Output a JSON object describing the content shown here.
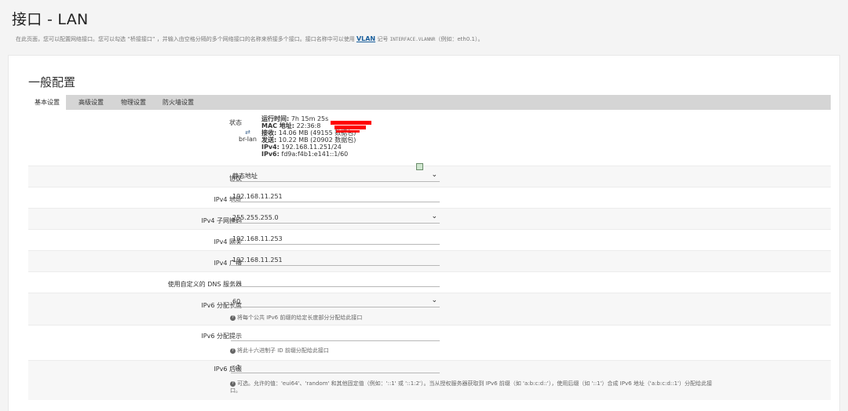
{
  "page": {
    "title": "接口 - LAN",
    "description_before": "在此页面，您可以配置网络接口。您可以勾选 “桥接接口” ，并输入由空格分隔的多个网络接口的名称来桥接多个接口。接口名称中可以使用 ",
    "description_link": "VLAN",
    "description_after": " 记号 ",
    "description_mono": "INTERFACE.VLANNR",
    "description_end": "（例如：eth0.1）。"
  },
  "section": {
    "title": "一般配置"
  },
  "tabs": [
    {
      "label": "基本设置",
      "active": true
    },
    {
      "label": "高级设置",
      "active": false
    },
    {
      "label": "物理设置",
      "active": false
    },
    {
      "label": "防火墙设置",
      "active": false
    }
  ],
  "status": {
    "label": "状态",
    "device": "br-lan",
    "uptime_k": "运行时间:",
    "uptime_v": "7h 15m 25s",
    "mac_k": "MAC 地址:",
    "mac_v": "22:36:8",
    "rx_k": "接收:",
    "rx_v": "14.06 MB (49155 数据包)",
    "tx_k": "发送:",
    "tx_v": "10.22 MB (20902 数据包)",
    "ipv4_k": "IPv4:",
    "ipv4_v": "192.168.11.251/24",
    "ipv6_k": "IPv6:",
    "ipv6_v": "fd9a:f4b1:e141::1/60"
  },
  "fields": {
    "protocol": {
      "label": "协议",
      "value": "静态地址"
    },
    "ipv4_addr": {
      "label": "IPv4 地址",
      "value": "192.168.11.251"
    },
    "ipv4_mask": {
      "label": "IPv4 子网掩码",
      "value": "255.255.255.0"
    },
    "ipv4_gw": {
      "label": "IPv4 网关",
      "value": "192.168.11.253"
    },
    "ipv4_bcast": {
      "label": "IPv4 广播",
      "value": "192.168.11.251"
    },
    "dns": {
      "label": "使用自定义的 DNS 服务器",
      "value": ""
    },
    "ip6_len": {
      "label": "IPv6 分配长度",
      "value": "60",
      "hint": "将每个公共 IPv6 前缀的给定长度部分分配给此接口"
    },
    "ip6_hint": {
      "label": "IPv6 分配提示",
      "value": "",
      "hint": "将此十六进制子 ID 前缀分配给此接口"
    },
    "ip6_suffix": {
      "label": "IPv6 后缀",
      "value": "::1",
      "hint_line1": "可选。允许的值：'eui64'、'random' 和其他固定值（例如：'::1' 或 '::1:2'）。当从授权服务器获取到 IPv6 前缀（如 'a:b:c:d::'），使用后缀（如 '::1'）合成 IPv6 地址（'a:b:c:d::1'）分配给此接",
      "hint_line2": "口。"
    }
  },
  "colors": {
    "accent_link": "#1a5f9c",
    "tab_bar": "#d5d5d5",
    "redaction": "#ff0000"
  }
}
